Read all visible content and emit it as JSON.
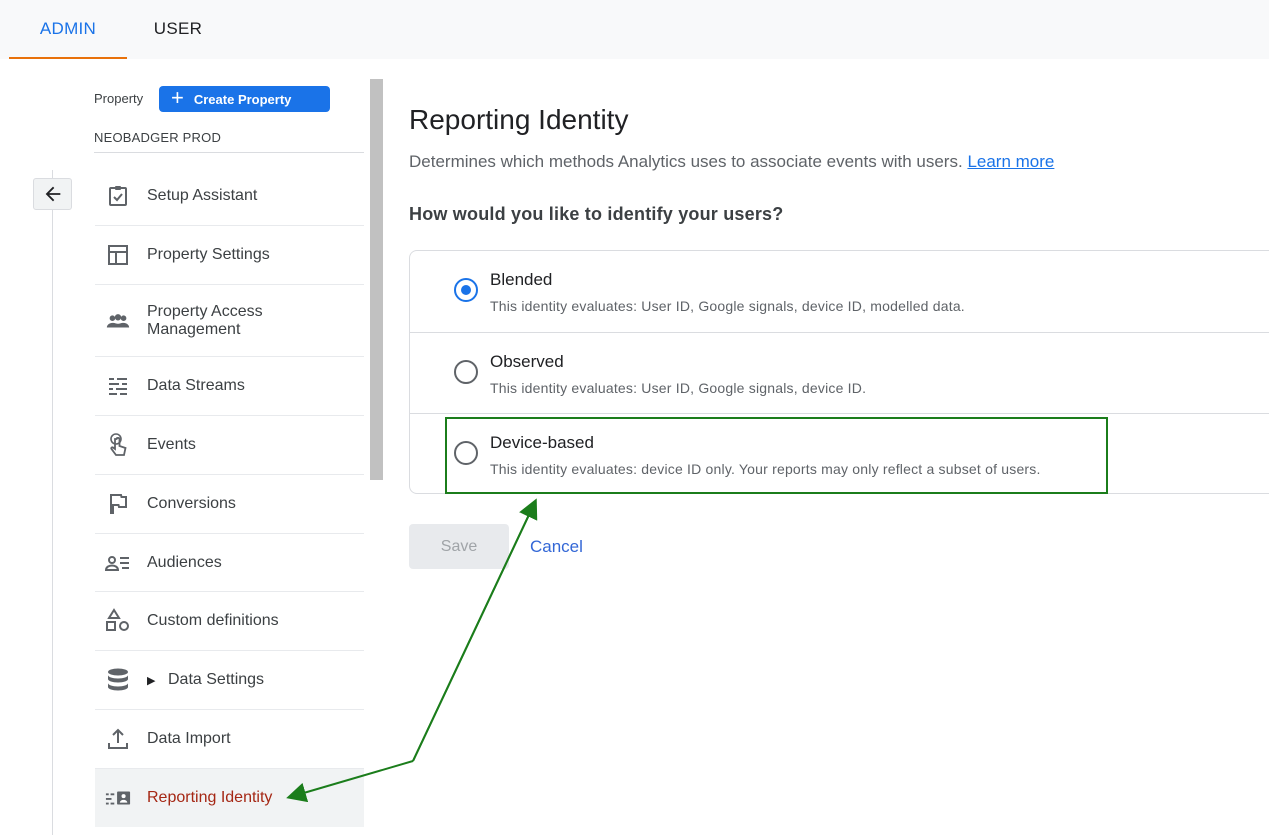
{
  "tabs": {
    "admin": "ADMIN",
    "user": "USER"
  },
  "property": {
    "label": "Property",
    "create_button": "Create Property",
    "name": "NEOBADGER PROD"
  },
  "nav": {
    "items": [
      {
        "label": "Setup Assistant",
        "icon": "checklist-icon"
      },
      {
        "label": "Property Settings",
        "icon": "layout-icon"
      },
      {
        "label": "Property Access Management",
        "icon": "people-icon"
      },
      {
        "label": "Data Streams",
        "icon": "streams-icon"
      },
      {
        "label": "Events",
        "icon": "touch-icon"
      },
      {
        "label": "Conversions",
        "icon": "flag-icon"
      },
      {
        "label": "Audiences",
        "icon": "audience-icon"
      },
      {
        "label": "Custom definitions",
        "icon": "shapes-icon"
      },
      {
        "label": "Data Settings",
        "icon": "database-icon"
      },
      {
        "label": "Data Import",
        "icon": "upload-icon"
      },
      {
        "label": "Reporting Identity",
        "icon": "identity-icon"
      }
    ]
  },
  "main": {
    "title": "Reporting Identity",
    "description": "Determines which methods Analytics uses to associate events with users.",
    "learn_more": "Learn more",
    "question": "How would you like to identify your users?",
    "options": [
      {
        "title": "Blended",
        "description": "This identity evaluates: User ID, Google signals, device ID, modelled data.",
        "selected": true
      },
      {
        "title": "Observed",
        "description": "This identity evaluates: User ID, Google signals, device ID.",
        "selected": false
      },
      {
        "title": "Device-based",
        "description": "This identity evaluates: device ID only. Your reports may only reflect a subset of users.",
        "selected": false
      }
    ],
    "save": "Save",
    "cancel": "Cancel"
  },
  "colors": {
    "accent": "#1a73e8",
    "tab_underline": "#e8710a",
    "active_nav": "#a52714",
    "annotation": "#1b7d1b"
  }
}
